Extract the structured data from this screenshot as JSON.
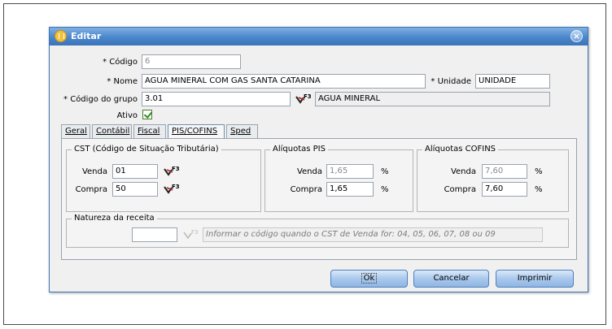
{
  "window": {
    "title": "Editar",
    "close_glyph": "×"
  },
  "form": {
    "codigo": {
      "label": "* Código",
      "value": "6"
    },
    "nome": {
      "label": "* Nome",
      "value": "AGUA MINERAL COM GAS SANTA CATARINA"
    },
    "unidade": {
      "label": "* Unidade",
      "value": "UNIDADE"
    },
    "codigo_grupo": {
      "label": "* Código do grupo",
      "value": "3.01",
      "description": "AGUA MINERAL"
    },
    "ativo": {
      "label": "Ativo",
      "checked": true
    }
  },
  "tabs": [
    {
      "label": "Geral",
      "active": false
    },
    {
      "label": "Contábil",
      "active": false
    },
    {
      "label": "Fiscal",
      "active": false
    },
    {
      "label": "PIS/COFINS",
      "active": true
    },
    {
      "label": "Sped",
      "active": false
    }
  ],
  "cst": {
    "title": "CST (Código de Situação Tributária)",
    "venda_label": "Venda",
    "venda_value": "01",
    "compra_label": "Compra",
    "compra_value": "50"
  },
  "pis": {
    "title": "Alíquotas PIS",
    "venda_label": "Venda",
    "venda_value": "1,65",
    "compra_label": "Compra",
    "compra_value": "1,65",
    "unit": "%"
  },
  "cofins": {
    "title": "Alíquotas COFINS",
    "venda_label": "Venda",
    "venda_value": "7,60",
    "compra_label": "Compra",
    "compra_value": "7,60",
    "unit": "%"
  },
  "natureza": {
    "title": "Natureza da receita",
    "value": "",
    "hint": "Informar o código quando o CST de Venda for: 04, 05, 06, 07, 08 ou 09"
  },
  "buttons": {
    "ok": "Ok",
    "cancelar": "Cancelar",
    "imprimir": "Imprimir"
  },
  "icons": {
    "lookup": "f3-lookup-icon",
    "lookup_key_text": "F3"
  }
}
